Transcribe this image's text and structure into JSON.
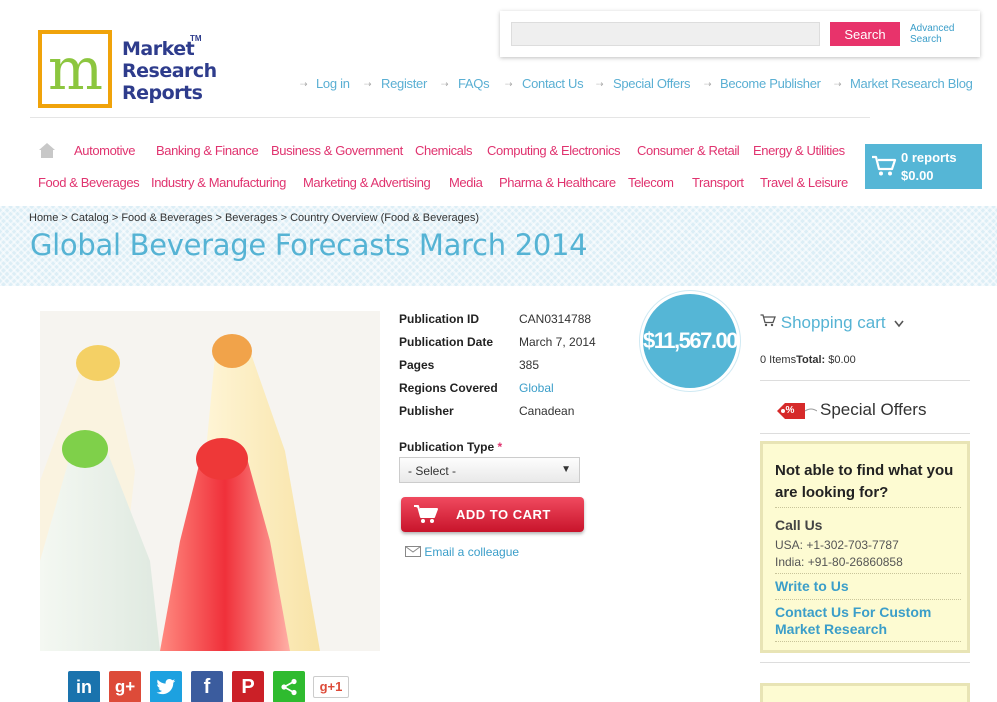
{
  "logo": {
    "line1": "Market",
    "line2": "Research",
    "line3": "Reports",
    "tm": "TM",
    "letter": "m"
  },
  "search": {
    "placeholder": "",
    "button": "Search",
    "advanced_line1": "Advanced",
    "advanced_line2": "Search"
  },
  "toplinks": [
    "Log in",
    "Register",
    "FAQs",
    "Contact Us",
    "Special Offers",
    "Become Publisher",
    "Market Research Blog"
  ],
  "categories_row1": [
    "Automotive",
    "Banking & Finance",
    "Business & Government",
    "Chemicals",
    "Computing & Electronics",
    "Consumer & Retail",
    "Energy & Utilities"
  ],
  "categories_row2": [
    "Food & Beverages",
    "Industry & Manufacturing",
    "Marketing & Advertising",
    "Media",
    "Pharma & Healthcare",
    "Telecom",
    "Transport",
    "Travel & Leisure"
  ],
  "cart": {
    "reports": "0 reports",
    "total": "$0.00"
  },
  "breadcrumb": "Home > Catalog > Food & Beverages > Beverages > Country Overview (Food & Beverages)",
  "page_title": "Global Beverage Forecasts March 2014",
  "details": {
    "labels": [
      "Publication ID",
      "Publication Date",
      "Pages",
      "Regions Covered",
      "Publisher"
    ],
    "values": [
      "CAN0314788",
      "March 7, 2014",
      "385",
      "Global",
      "Canadean"
    ]
  },
  "price": "$11,567.00",
  "publication_type": {
    "label": "Publication Type",
    "required_mark": "*",
    "selected": "- Select -"
  },
  "add_to_cart": "ADD TO CART",
  "email_colleague": "Email a colleague",
  "social": {
    "gplus_count_label": "g+1"
  },
  "sidebar": {
    "cart_title": "Shopping cart",
    "items_text": "0 Items",
    "total_label": "Total:",
    "total_value": "$0.00",
    "special_offers": "Special Offers",
    "special_offers_tag": "%",
    "help": {
      "question": "Not able to find what you are looking for?",
      "call_us": "Call Us",
      "usa": "USA: +1-302-703-7787",
      "india": "India: +91-80-26860858",
      "write": "Write to Us",
      "custom": "Contact Us For Custom Market Research"
    }
  },
  "colors": {
    "accent_blue": "#55b6d6",
    "accent_pink": "#e0336f",
    "search_pink": "#e8336b",
    "add_cart_red": "#d81f36"
  }
}
